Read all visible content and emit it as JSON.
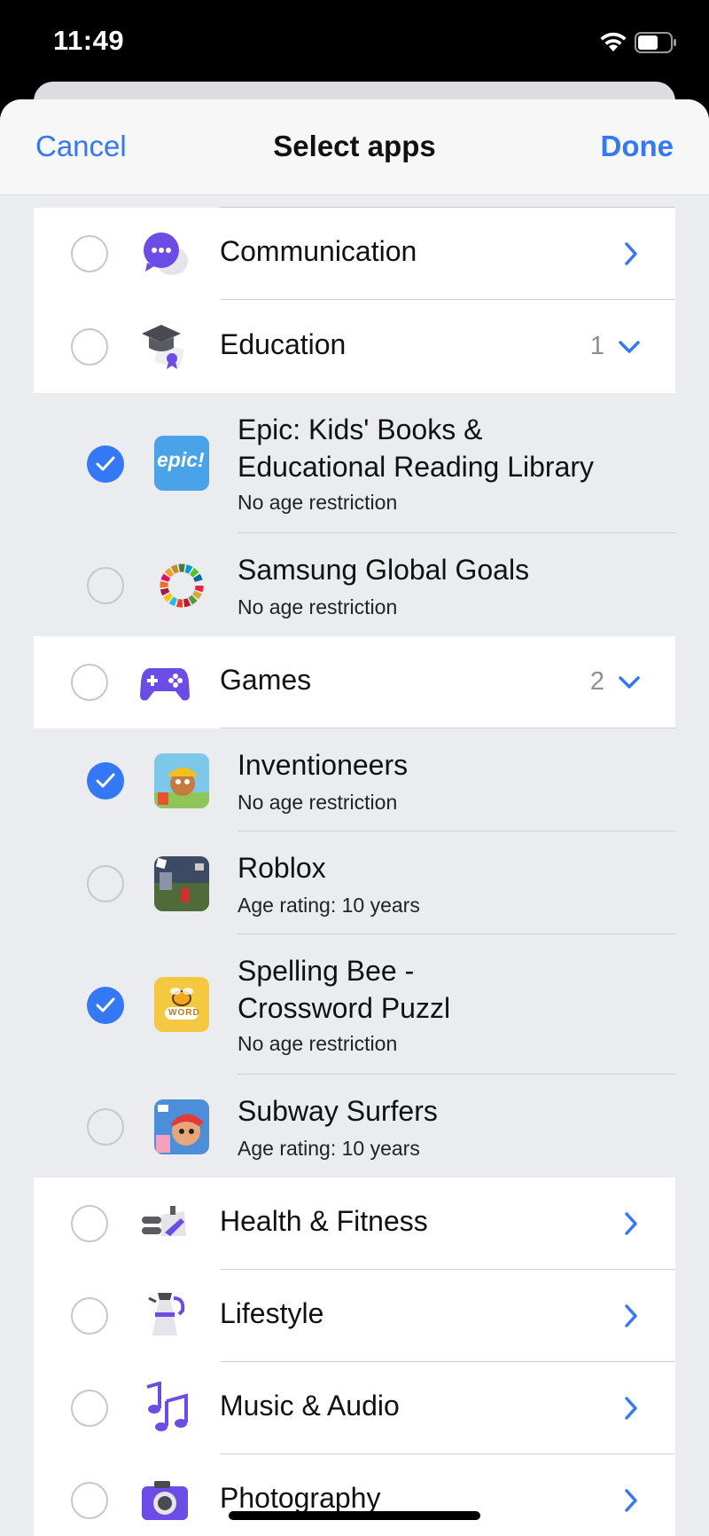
{
  "status": {
    "time": "11:49"
  },
  "nav": {
    "cancel": "Cancel",
    "title": "Select apps",
    "done": "Done"
  },
  "categories": {
    "communication": {
      "label": "Communication"
    },
    "education": {
      "label": "Education",
      "count": "1"
    },
    "games": {
      "label": "Games",
      "count": "2"
    },
    "health": {
      "label": "Health & Fitness"
    },
    "lifestyle": {
      "label": "Lifestyle"
    },
    "music": {
      "label": "Music & Audio"
    },
    "photography": {
      "label": "Photography"
    }
  },
  "apps": {
    "epic": {
      "name_line1": "Epic: Kids' Books &",
      "name_line2": "Educational Reading Library",
      "rating": "No age restriction",
      "checked": true,
      "icon_text": "epic!"
    },
    "samsung": {
      "name": "Samsung Global Goals",
      "rating": "No age restriction",
      "checked": false
    },
    "inventioneers": {
      "name": "Inventioneers",
      "rating": "No age restriction",
      "checked": true
    },
    "roblox": {
      "name": "Roblox",
      "rating": "Age rating: 10 years",
      "checked": false
    },
    "spelling": {
      "name_line1": "Spelling Bee -",
      "name_line2": "Crossword Puzzl",
      "rating": "No age restriction",
      "checked": true,
      "icon_text": "WORD"
    },
    "subway": {
      "name": "Subway Surfers",
      "rating": "Age rating: 10 years",
      "checked": false
    }
  },
  "colors": {
    "accent": "#3478f6",
    "purple": "#6b4ce6",
    "background": "#eaecf0"
  }
}
